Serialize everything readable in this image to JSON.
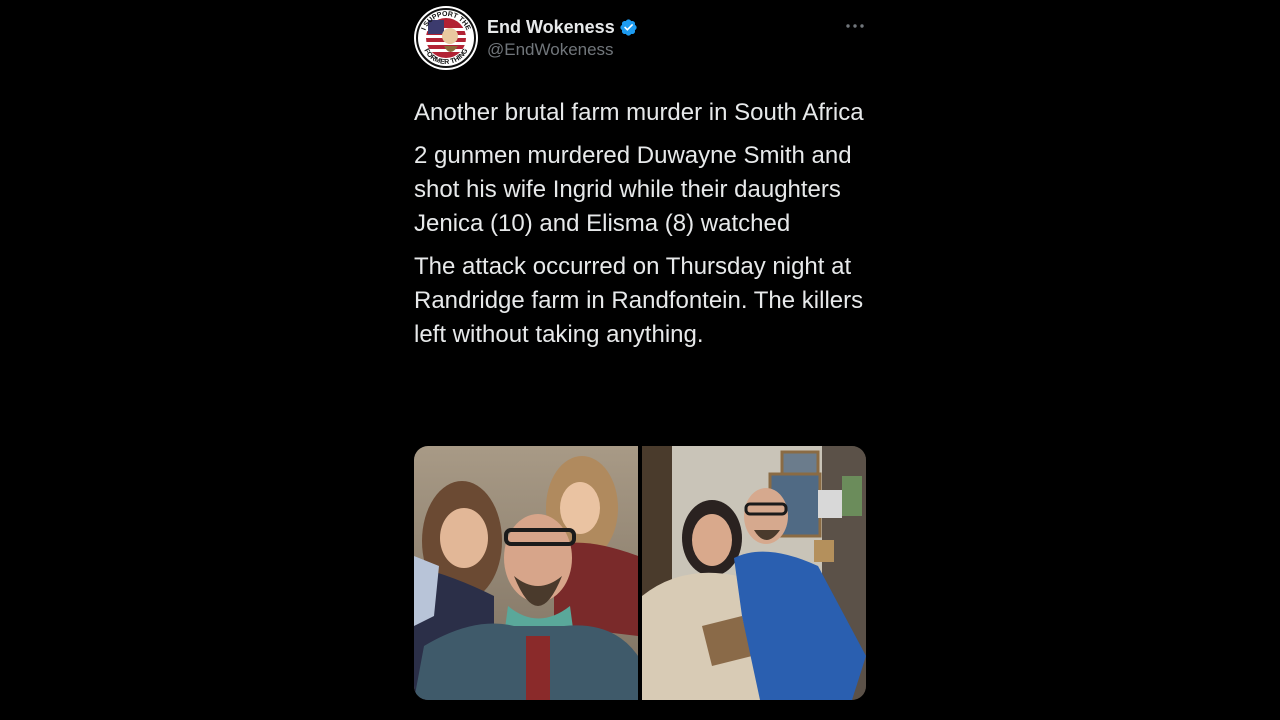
{
  "tweet": {
    "author": {
      "display_name": "End Wokeness",
      "handle": "@EndWokeness",
      "verified": true,
      "avatar_icon": "avatar-flag-badge-icon",
      "avatar_badge_top": "I SUPPORT THE",
      "avatar_badge_bottom": "FORMER THING"
    },
    "more_icon": "ellipsis-icon",
    "paragraphs": [
      "Another brutal farm murder in South Africa",
      "2 gunmen murdered Duwayne Smith and shot his wife Ingrid while their daughters Jenica (10) and Elisma (8) watched",
      "The attack occurred on Thursday night at Randridge farm in Randfontein. The killers left without taking anything."
    ],
    "media": [
      {
        "name": "family-selfie-photo"
      },
      {
        "name": "couple-photo"
      }
    ]
  },
  "colors": {
    "background": "#000000",
    "primary_text": "#e7e9ea",
    "secondary_text": "#71767b",
    "verified_blue": "#1d9bf0"
  }
}
